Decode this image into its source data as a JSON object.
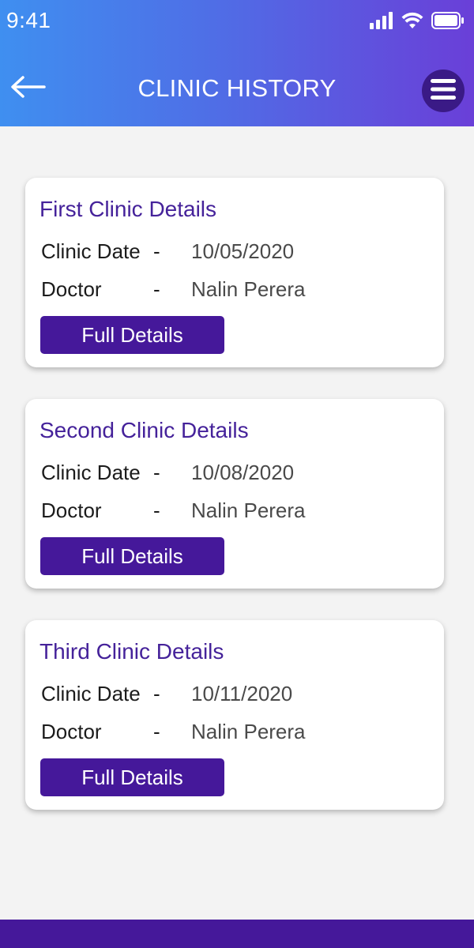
{
  "status": {
    "time": "9:41"
  },
  "header": {
    "title": "CLINIC HISTORY"
  },
  "icons": {
    "back": "arrow-left-icon",
    "menu": "hamburger-menu-icon",
    "signal": "cellular-signal-icon",
    "wifi": "wifi-icon",
    "battery": "battery-icon"
  },
  "colors": {
    "header_gradient_start": "#3f8ff0",
    "header_gradient_end": "#6a3fd8",
    "accent": "#45189a",
    "card_title": "#45229a",
    "background": "#f3f3f3"
  },
  "clinics": [
    {
      "title": "First Clinic Details",
      "date_label": "Clinic Date",
      "date": "10/05/2020",
      "doctor_label": "Doctor",
      "doctor": "Nalin Perera",
      "separator": "-",
      "button": "Full Details"
    },
    {
      "title": "Second Clinic Details",
      "date_label": "Clinic Date",
      "date": "10/08/2020",
      "doctor_label": "Doctor",
      "doctor": "Nalin Perera",
      "separator": "-",
      "button": "Full Details"
    },
    {
      "title": "Third Clinic Details",
      "date_label": "Clinic Date",
      "date": "10/11/2020",
      "doctor_label": "Doctor",
      "doctor": "Nalin Perera",
      "separator": "-",
      "button": "Full Details"
    }
  ]
}
